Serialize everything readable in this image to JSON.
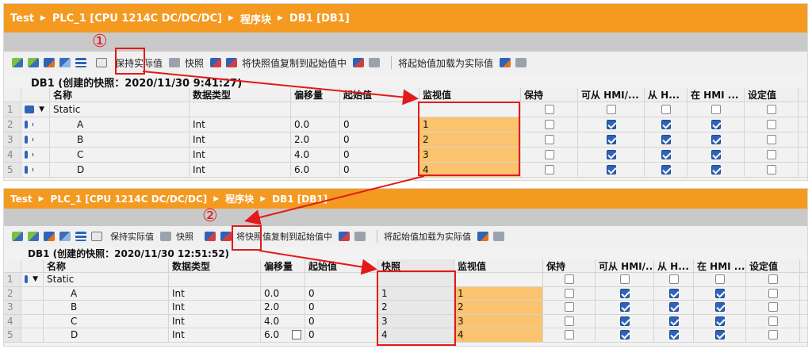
{
  "breadcrumb": [
    "Test",
    "PLC_1 [CPU 1214C DC/DC/DC]",
    "程序块",
    "DB1 [DB1]"
  ],
  "colors": {
    "titlebar": "#f49a20",
    "monitor_cell": "#fbc36d",
    "annotation": "#e11b1b",
    "checkbox_on": "#2e63b8"
  },
  "toolbar": {
    "keep_actual": "保持实际值",
    "snapshot": "快照",
    "copy_snapshot": "将快照值复制到起始值中",
    "load_start": "将起始值加载为实际值"
  },
  "annotations": {
    "step1": "①",
    "step2": "②"
  },
  "top": {
    "snapshot_line": "DB1 (创建的快照：2020/11/30 9:41:27)",
    "headers": [
      "名称",
      "数据类型",
      "偏移量",
      "起始值",
      "监视值",
      "保持",
      "可从 HMI/...",
      "从 H...",
      "在 HMI ...",
      "设定值"
    ],
    "rows": [
      {
        "num": "1",
        "name": "Static",
        "type": "",
        "offset": "",
        "start": "",
        "monitor": ""
      },
      {
        "num": "2",
        "name": "A",
        "type": "Int",
        "offset": "0.0",
        "start": "0",
        "monitor": "1"
      },
      {
        "num": "3",
        "name": "B",
        "type": "Int",
        "offset": "2.0",
        "start": "0",
        "monitor": "2"
      },
      {
        "num": "4",
        "name": "C",
        "type": "Int",
        "offset": "4.0",
        "start": "0",
        "monitor": "3"
      },
      {
        "num": "5",
        "name": "D",
        "type": "Int",
        "offset": "6.0",
        "start": "0",
        "monitor": "4"
      }
    ]
  },
  "bottom": {
    "snapshot_line": "DB1 (创建的快照：2020/11/30 12:51:52)",
    "headers": [
      "名称",
      "数据类型",
      "偏移量",
      "起始值",
      "快照",
      "监视值",
      "保持",
      "可从 HMI/...",
      "从 H...",
      "在 HMI ...",
      "设定值"
    ],
    "rows": [
      {
        "num": "1",
        "name": "Static",
        "type": "",
        "offset": "",
        "start": "",
        "snapshot": "",
        "monitor": ""
      },
      {
        "num": "2",
        "name": "A",
        "type": "Int",
        "offset": "0.0",
        "start": "0",
        "snapshot": "1",
        "monitor": "1"
      },
      {
        "num": "3",
        "name": "B",
        "type": "Int",
        "offset": "2.0",
        "start": "0",
        "snapshot": "2",
        "monitor": "2"
      },
      {
        "num": "4",
        "name": "C",
        "type": "Int",
        "offset": "4.0",
        "start": "0",
        "snapshot": "3",
        "monitor": "3"
      },
      {
        "num": "5",
        "name": "D",
        "type": "Int",
        "offset": "6.0",
        "start": "0",
        "snapshot": "4",
        "monitor": "4"
      }
    ]
  }
}
